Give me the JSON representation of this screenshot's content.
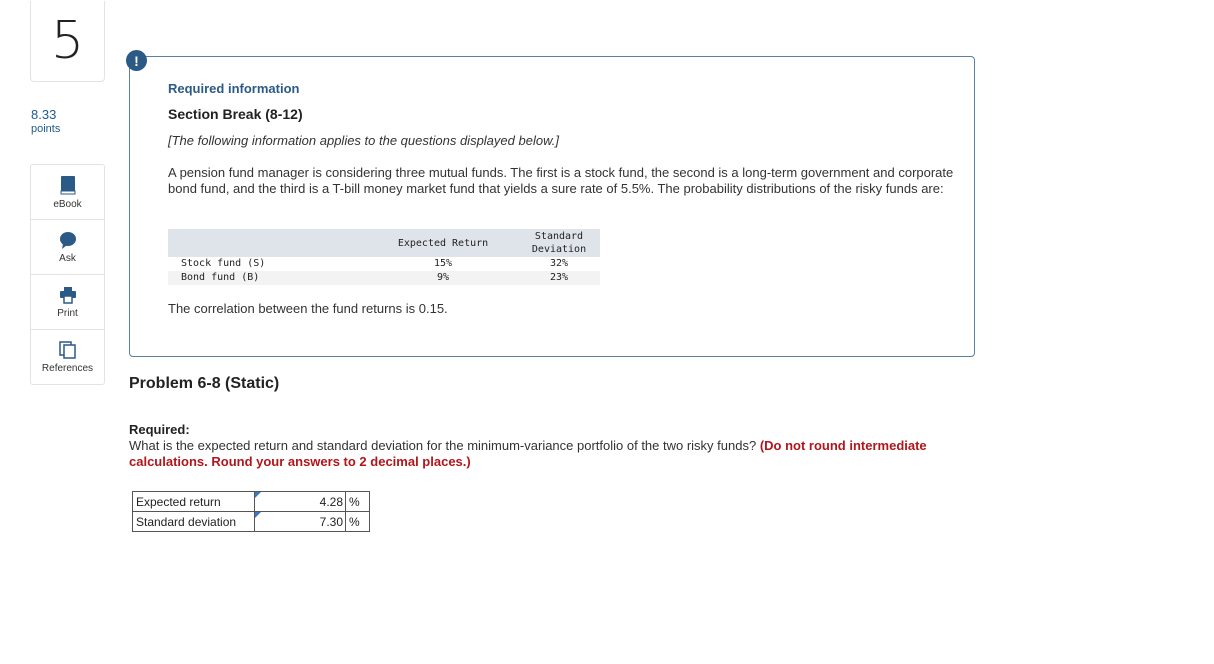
{
  "question": {
    "number": "5",
    "points_value": "8.33",
    "points_label": "points"
  },
  "tools": [
    {
      "label": "eBook",
      "icon": "book-icon"
    },
    {
      "label": "Ask",
      "icon": "speech-bubble-icon"
    },
    {
      "label": "Print",
      "icon": "printer-icon"
    },
    {
      "label": "References",
      "icon": "documents-icon"
    }
  ],
  "info": {
    "alert_icon": "!",
    "heading": "Required information",
    "section": "Section Break (8-12)",
    "note": "[The following information applies to the questions displayed below.]",
    "paragraph": "A pension fund manager is considering three mutual funds. The first is a stock fund, the second is a long-term government and corporate bond fund, and the third is a T-bill money market fund that yields a sure rate of 5.5%. The probability distributions of the risky funds are:",
    "table": {
      "headers": [
        "",
        "Expected Return",
        "Standard Deviation"
      ],
      "rows": [
        {
          "name": "Stock fund (S)",
          "expected": "15%",
          "std": "32%"
        },
        {
          "name": "Bond fund (B)",
          "expected": "9%",
          "std": "23%"
        }
      ]
    },
    "correlation": "The correlation between the fund returns is 0.15."
  },
  "problem": {
    "title": "Problem 6-8 (Static)",
    "required_label": "Required:",
    "question": "What is the expected return and standard deviation for the minimum-variance portfolio of the two risky funds? ",
    "instruction": "(Do not round intermediate calculations. Round your answers to 2 decimal places.)",
    "answers": [
      {
        "label": "Expected return",
        "value": "4.28",
        "unit": "%"
      },
      {
        "label": "Standard deviation",
        "value": "7.30",
        "unit": "%"
      }
    ]
  },
  "colors": {
    "accent": "#2c5a86",
    "warning": "#b0161c",
    "tool_icon": "#2c5a86"
  }
}
